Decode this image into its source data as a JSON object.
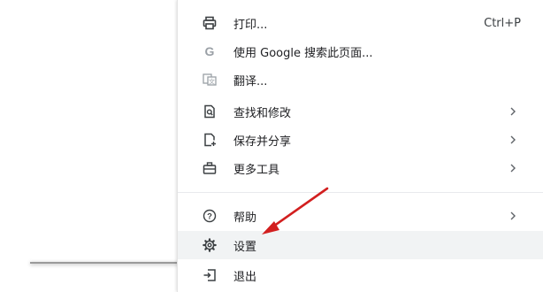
{
  "menu": {
    "items": [
      {
        "id": "print",
        "label": "打印...",
        "shortcut": "Ctrl+P",
        "icon": "printer-icon"
      },
      {
        "id": "google-search",
        "label": "使用 Google 搜索此页面...",
        "icon": "google-g-icon"
      },
      {
        "id": "translate",
        "label": "翻译...",
        "icon": "translate-icon"
      },
      {
        "id": "find-edit",
        "label": "查找和修改",
        "icon": "find-page-icon",
        "submenu": true
      },
      {
        "id": "save-share",
        "label": "保存并分享",
        "icon": "save-share-icon",
        "submenu": true
      },
      {
        "id": "more-tools",
        "label": "更多工具",
        "icon": "toolbox-icon",
        "submenu": true
      },
      {
        "id": "help",
        "label": "帮助",
        "icon": "help-icon",
        "submenu": true
      },
      {
        "id": "settings",
        "label": "设置",
        "icon": "gear-icon",
        "highlighted": true
      },
      {
        "id": "exit",
        "label": "退出",
        "icon": "exit-icon"
      }
    ]
  },
  "annotation": {
    "arrow_color": "#d21f1f",
    "points_to": "settings"
  }
}
